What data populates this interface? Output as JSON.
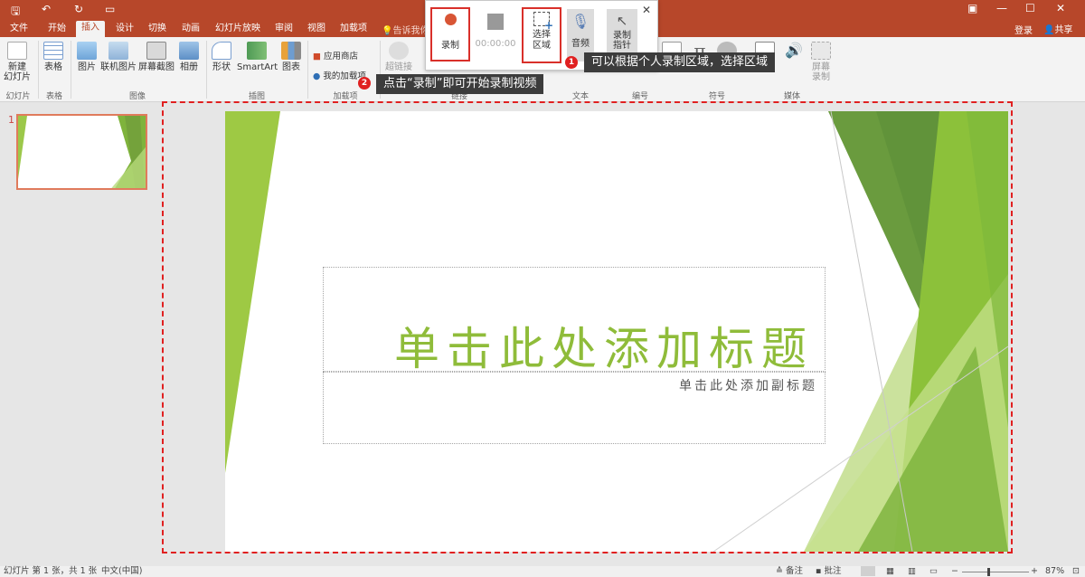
{
  "ribbon_tabs": [
    "文件",
    "开始",
    "插入",
    "设计",
    "切换",
    "动画",
    "幻灯片放映",
    "审阅",
    "视图",
    "加载项"
  ],
  "active_tab": "插入",
  "tell_me": "告诉我你",
  "account": {
    "login": "登录",
    "share": "共享"
  },
  "ribbon": {
    "new_slide": "新建\n幻灯片",
    "table": "表格",
    "picture": "图片",
    "online_picture": "联机图片",
    "screenshot": "屏幕截图",
    "album": "相册",
    "shapes": "形状",
    "smartart": "SmartArt",
    "chart": "图表",
    "store": "应用商店",
    "my_addins": "我的加载项",
    "hyperlink": "超链接",
    "screen_record": "屏幕\n录制",
    "groups": {
      "slides": "幻灯片",
      "tables": "表格",
      "images": "图像",
      "illustrations": "插图",
      "addins": "加载项",
      "links": "链接",
      "text": "文本",
      "numbering": "编号",
      "symbols": "符号",
      "media": "媒体"
    }
  },
  "recorder": {
    "record": "录制",
    "timer": "00:00:00",
    "select_area": "选择\n区域",
    "audio": "音频",
    "record_pointer": "录制\n指针"
  },
  "annotations": {
    "step1_num": "1",
    "step1_text": "可以根据个人录制区域，选择区域",
    "step2_num": "2",
    "step2_text": "点击“录制”即可开始录制视频"
  },
  "slide_panel": {
    "number": "1"
  },
  "slide": {
    "title": "单击此处添加标题",
    "subtitle": "单击此处添加副标题"
  },
  "status": {
    "left": "幻灯片 第 1 张，共 1 张",
    "lang": "中文(中国)",
    "notes": "备注",
    "comments": "批注",
    "zoom": "87%"
  },
  "colors": {
    "accent": "#b7472a",
    "slide_green": "#8fbc3a",
    "annotation_red": "#e02020"
  }
}
